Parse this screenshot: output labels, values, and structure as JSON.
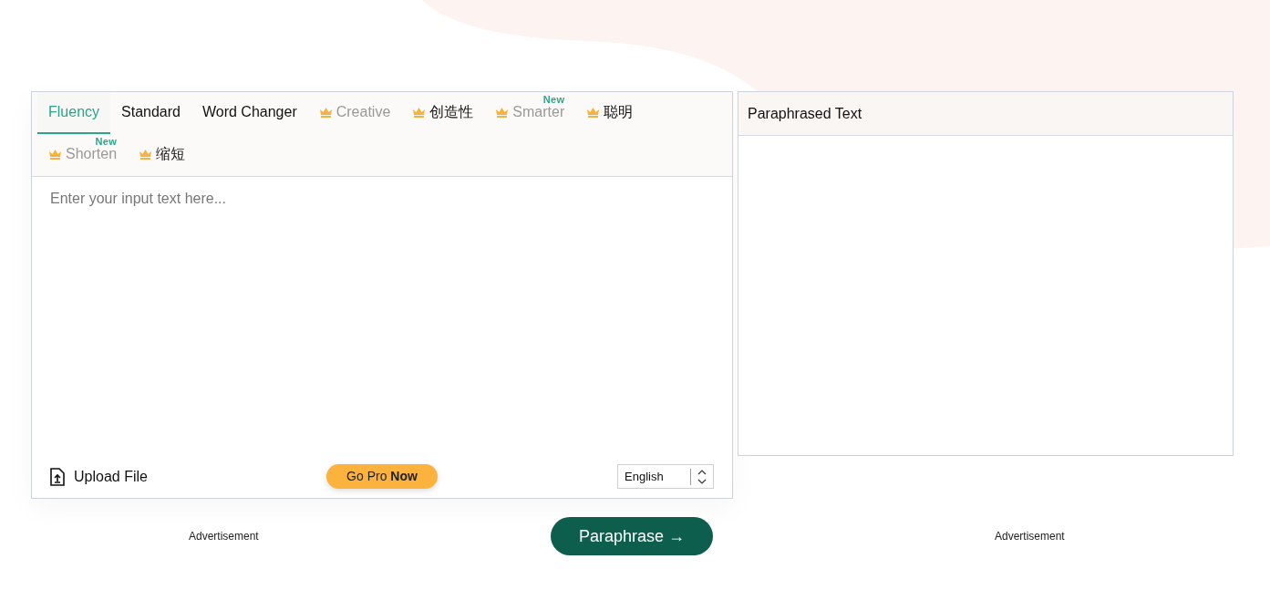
{
  "modes": [
    {
      "label": "Fluency",
      "selected": true,
      "premium": false,
      "disabled": false
    },
    {
      "label": "Standard",
      "selected": false,
      "premium": false,
      "disabled": false
    },
    {
      "label": "Word Changer",
      "selected": false,
      "premium": false,
      "disabled": false
    },
    {
      "label": "Creative",
      "selected": false,
      "premium": true,
      "disabled": true
    },
    {
      "label": "创造性",
      "selected": false,
      "premium": true,
      "disabled": false
    },
    {
      "label": "Smarter",
      "selected": false,
      "premium": true,
      "disabled": true,
      "badge": "New"
    },
    {
      "label": "聪明",
      "selected": false,
      "premium": true,
      "disabled": false
    },
    {
      "label": "Shorten",
      "selected": false,
      "premium": true,
      "disabled": true,
      "badge": "New"
    },
    {
      "label": "缩短",
      "selected": false,
      "premium": true,
      "disabled": false
    }
  ],
  "input": {
    "placeholder": "Enter your input text here..."
  },
  "upload": "Upload File",
  "go_pro": "Go Pro **Now**",
  "language": "English",
  "output": {
    "title": "Paraphrased Text"
  },
  "ads": [
    "Advertisement",
    "Advertisement"
  ],
  "paraphrase_button": "Paraphrase →"
}
